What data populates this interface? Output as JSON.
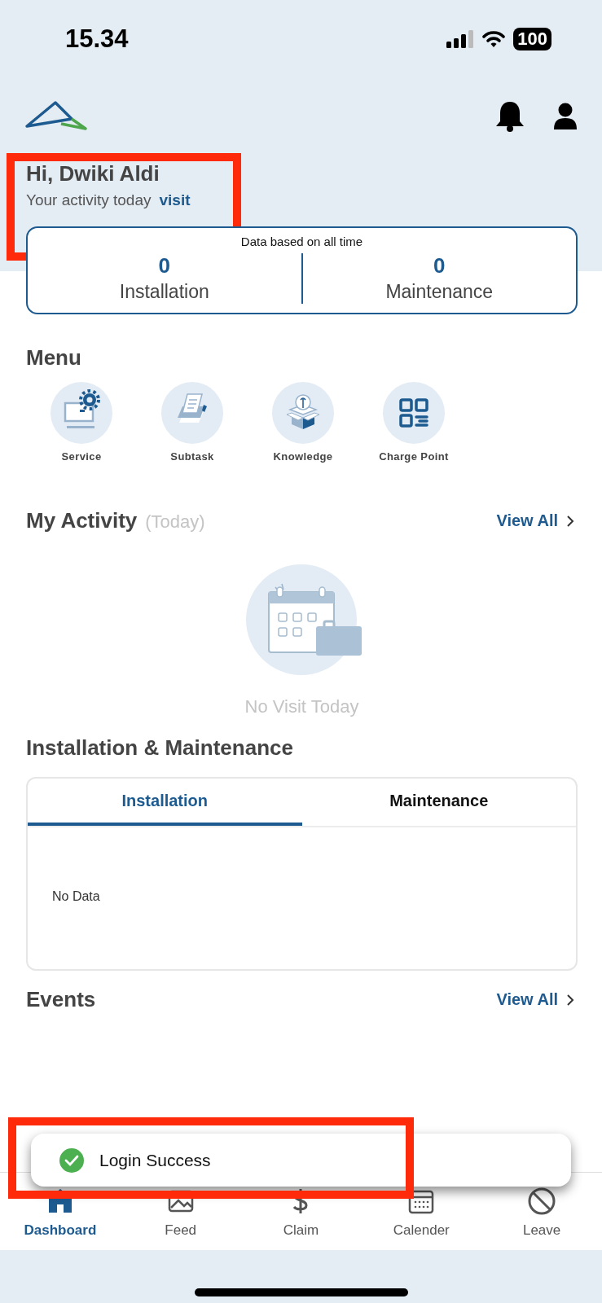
{
  "status_bar": {
    "time": "15.34",
    "battery": "100"
  },
  "greeting": {
    "title": "Hi, Dwiki Aldi",
    "subtitle": "Your activity today",
    "link": "visit",
    "highlighted": true
  },
  "stats": {
    "caption": "Data based on all time",
    "items": [
      {
        "value": "0",
        "label": "Installation"
      },
      {
        "value": "0",
        "label": "Maintenance"
      }
    ]
  },
  "menu": {
    "title": "Menu",
    "items": [
      {
        "label": "Service",
        "kind": "service"
      },
      {
        "label": "Subtask",
        "kind": "subtask"
      },
      {
        "label": "Knowledge",
        "kind": "knowledge"
      },
      {
        "label": "Charge Point",
        "kind": "grid"
      }
    ]
  },
  "activity": {
    "title": "My Activity",
    "qualifier": "(Today)",
    "view_all": "View All",
    "empty": "No Visit Today"
  },
  "install_maint": {
    "title": "Installation & Maintenance",
    "tabs": [
      {
        "label": "Installation",
        "selected": true
      },
      {
        "label": "Maintenance",
        "selected": false
      }
    ],
    "empty": "No Data"
  },
  "events": {
    "title": "Events",
    "view_all": "View All"
  },
  "toast": {
    "message": "Login Success",
    "highlighted": true
  },
  "nav": [
    {
      "label": "Dashboard",
      "kind": "home",
      "selected": true
    },
    {
      "label": "Feed",
      "kind": "feed",
      "selected": false
    },
    {
      "label": "Claim",
      "kind": "claim",
      "selected": false
    },
    {
      "label": "Calender",
      "kind": "calendar",
      "selected": false
    },
    {
      "label": "Leave",
      "kind": "leave",
      "selected": false
    }
  ]
}
